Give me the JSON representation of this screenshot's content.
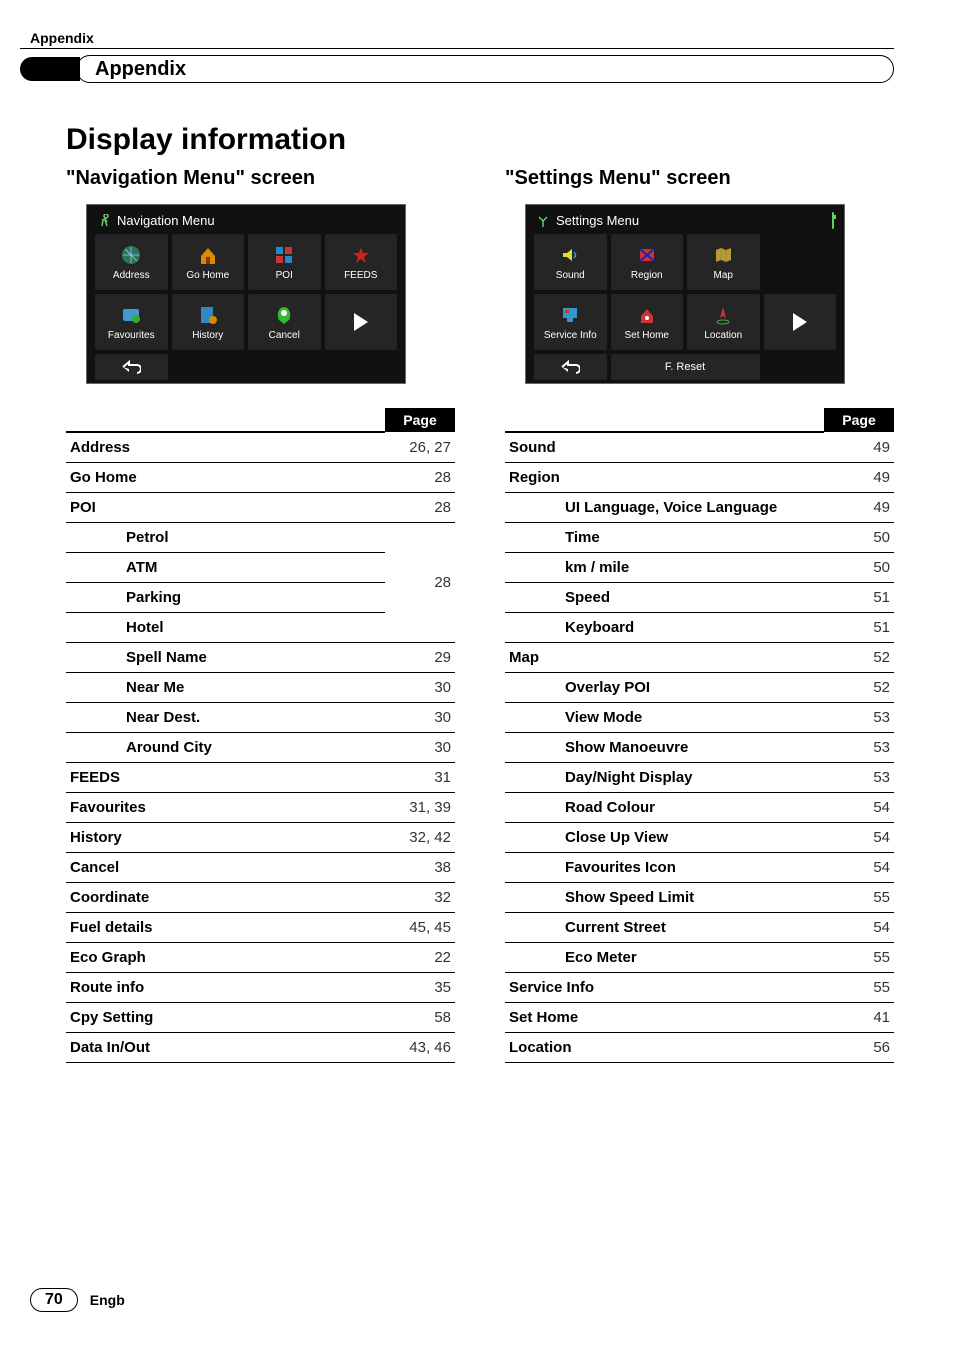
{
  "breadcrumb": "Appendix",
  "chapter_title": "Appendix",
  "section_title": "Display information",
  "nav_heading_quoted": "\"Navigation Menu\"",
  "nav_heading_screen": " screen",
  "set_heading_quoted": "\"Settings Menu\"",
  "set_heading_screen": " screen",
  "page_header_label": "Page",
  "nav_screenshot": {
    "title": "Navigation Menu",
    "row1": [
      {
        "label": "Address"
      },
      {
        "label": "Go Home"
      },
      {
        "label": "POI"
      },
      {
        "label": "FEEDS"
      }
    ],
    "row2": [
      {
        "label": "Favourites"
      },
      {
        "label": "History"
      },
      {
        "label": "Cancel"
      },
      {
        "label": ""
      }
    ]
  },
  "set_screenshot": {
    "title": "Settings Menu",
    "row1": [
      {
        "label": "Sound"
      },
      {
        "label": "Region"
      },
      {
        "label": "Map"
      },
      {
        "label": ""
      }
    ],
    "row2": [
      {
        "label": "Service Info"
      },
      {
        "label": "Set Home"
      },
      {
        "label": "Location"
      },
      {
        "label": ""
      }
    ],
    "f_reset": "F. Reset"
  },
  "nav_table": [
    {
      "label": "Address",
      "page": "26, 27"
    },
    {
      "label": "Go Home",
      "page": "28"
    },
    {
      "label": "POI",
      "page": "28"
    },
    {
      "sub": "Petrol",
      "group": true
    },
    {
      "sub": "ATM",
      "group": true,
      "page": "28",
      "page_rowspan": true
    },
    {
      "sub": "Parking",
      "group": true
    },
    {
      "sub": "Hotel",
      "group": true,
      "last_in_group": true
    },
    {
      "sub": "Spell Name",
      "page": "29"
    },
    {
      "sub": "Near Me",
      "page": "30"
    },
    {
      "sub": "Near Dest.",
      "page": "30"
    },
    {
      "sub": "Around City",
      "page": "30"
    },
    {
      "label": "FEEDS",
      "page": "31"
    },
    {
      "label": "Favourites",
      "page": "31, 39"
    },
    {
      "label": "History",
      "page": "32, 42"
    },
    {
      "label": "Cancel",
      "page": "38"
    },
    {
      "label": "Coordinate",
      "page": "32"
    },
    {
      "label": "Fuel details",
      "page": "45, 45"
    },
    {
      "label": "Eco Graph",
      "page": "22"
    },
    {
      "label": "Route info",
      "page": "35"
    },
    {
      "label": "Cpy Setting",
      "page": "58"
    },
    {
      "label": "Data In/Out",
      "page": "43, 46"
    }
  ],
  "set_table": [
    {
      "label": "Sound",
      "page": "49"
    },
    {
      "label": "Region",
      "page": "49"
    },
    {
      "sub": "UI Language, Voice Language",
      "page": "49"
    },
    {
      "sub": "Time",
      "page": "50"
    },
    {
      "sub": "km / mile",
      "page": "50"
    },
    {
      "sub": "Speed",
      "page": "51"
    },
    {
      "sub": "Keyboard",
      "page": "51"
    },
    {
      "label": "Map",
      "page": "52"
    },
    {
      "sub": "Overlay POI",
      "page": "52"
    },
    {
      "sub": "View Mode",
      "page": "53"
    },
    {
      "sub": "Show Manoeuvre",
      "page": "53"
    },
    {
      "sub": "Day/Night Display",
      "page": "53"
    },
    {
      "sub": "Road Colour",
      "page": "54"
    },
    {
      "sub": "Close Up View",
      "page": "54"
    },
    {
      "sub": "Favourites Icon",
      "page": "54"
    },
    {
      "sub": "Show Speed Limit",
      "page": "55"
    },
    {
      "sub": "Current Street",
      "page": "54"
    },
    {
      "sub": "Eco Meter",
      "page": "55"
    },
    {
      "label": "Service Info",
      "page": "55"
    },
    {
      "label": "Set Home",
      "page": "41"
    },
    {
      "label": "Location",
      "page": "56"
    }
  ],
  "footer": {
    "page_number": "70",
    "lang": "Engb"
  }
}
